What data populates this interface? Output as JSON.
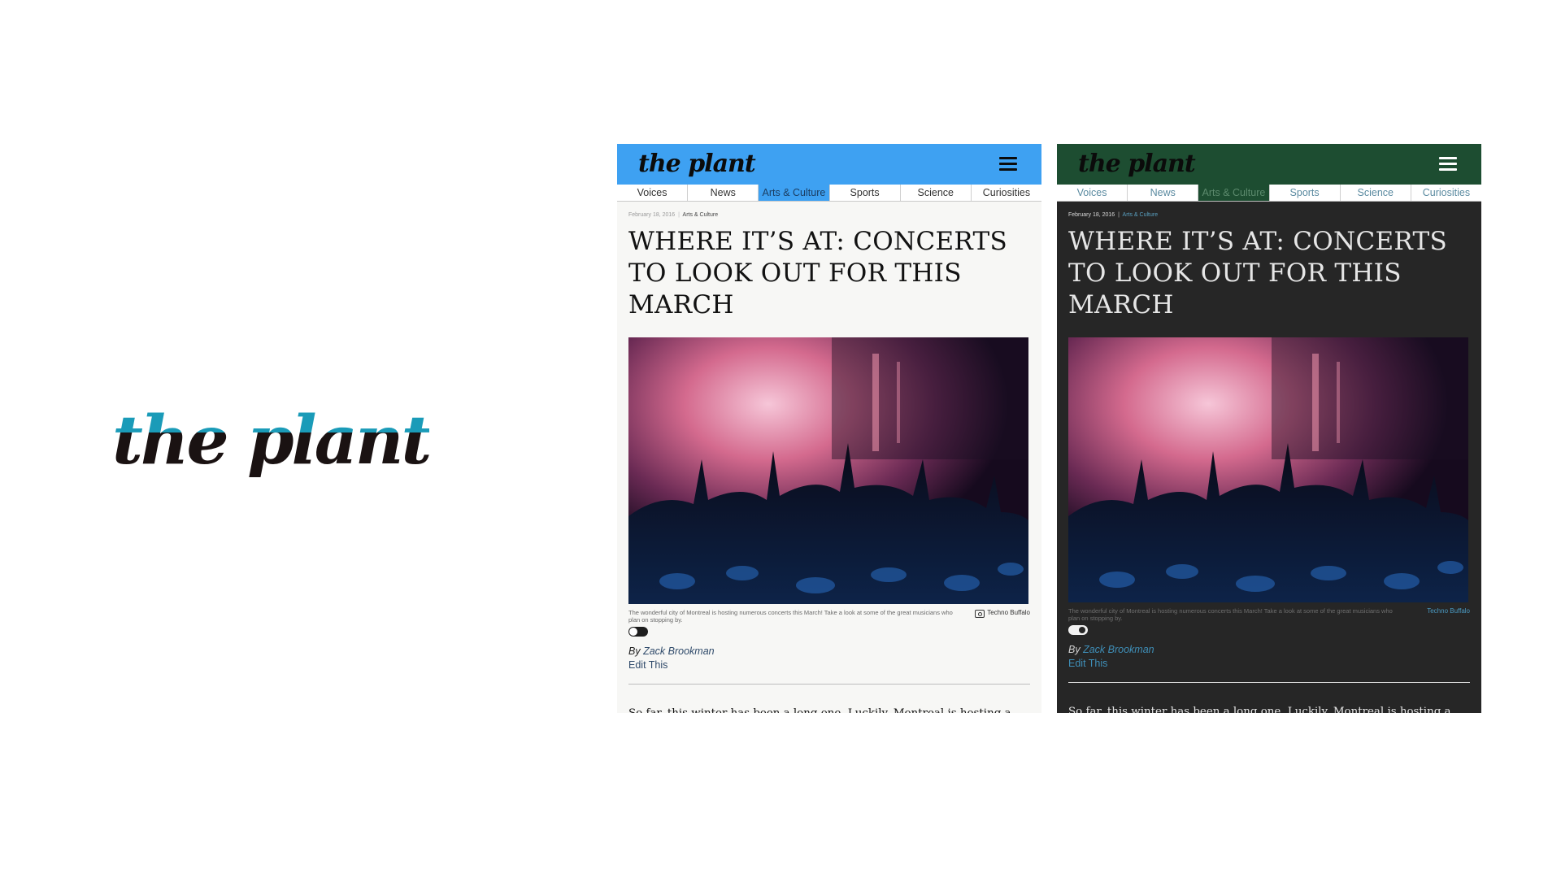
{
  "logo": {
    "text": "the plant",
    "colors": {
      "primary": "#1a1212",
      "accent": "#1a9bb8"
    }
  },
  "light": {
    "theme": {
      "header_bg": "#3ea1f2",
      "page_bg": "#f7f7f5"
    },
    "brand": "the plant",
    "menu_icon": "hamburger-menu-icon",
    "tabs": [
      "Voices",
      "News",
      "Arts & Culture",
      "Sports",
      "Science",
      "Curiosities"
    ],
    "active_tab": "Arts & Culture",
    "date": "February 18, 2016",
    "separator": "|",
    "category": "Arts & Culture",
    "headline": "WHERE IT’S AT: CONCERTS TO LOOK OUT FOR THIS MARCH",
    "caption": "The wonderful city of Montreal is hosting numerous concerts this March! Take a look at some of the great musicians who plan on stopping by.",
    "credit": "Techno Buffalo",
    "byline_prefix": "By",
    "author": "Zack Brookman",
    "edit": "Edit This",
    "body": "So far, this winter has been a long one. Luckily, Montreal is hosting a neat little number of shows this March that you’re sure to warm up to. Take a look at some of the great musicians making the trek north of the border"
  },
  "dark": {
    "theme": {
      "header_bg": "#1d4d31",
      "page_bg": "#262626"
    },
    "brand": "the plant",
    "menu_icon": "hamburger-menu-icon",
    "tabs": [
      "Voices",
      "News",
      "Arts & Culture",
      "Sports",
      "Science",
      "Curiosities"
    ],
    "active_tab": "Arts & Culture",
    "date": "February 18, 2016",
    "separator": "|",
    "category": "Arts & Culture",
    "headline": "WHERE IT’S AT: CONCERTS TO LOOK OUT FOR THIS MARCH",
    "caption": "The wonderful city of Montreal is hosting numerous concerts this March! Take a look at some of the great musicians who plan on stopping by.",
    "credit": "Techno Buffalo",
    "byline_prefix": "By",
    "author": "Zack Brookman",
    "edit": "Edit This",
    "body": "So far, this winter has been a long one. Luckily, Montreal is hosting a neat little number of shows this March that you’re sure to warm up to. Take a look at some of the great musicians making the trek north of the border"
  }
}
